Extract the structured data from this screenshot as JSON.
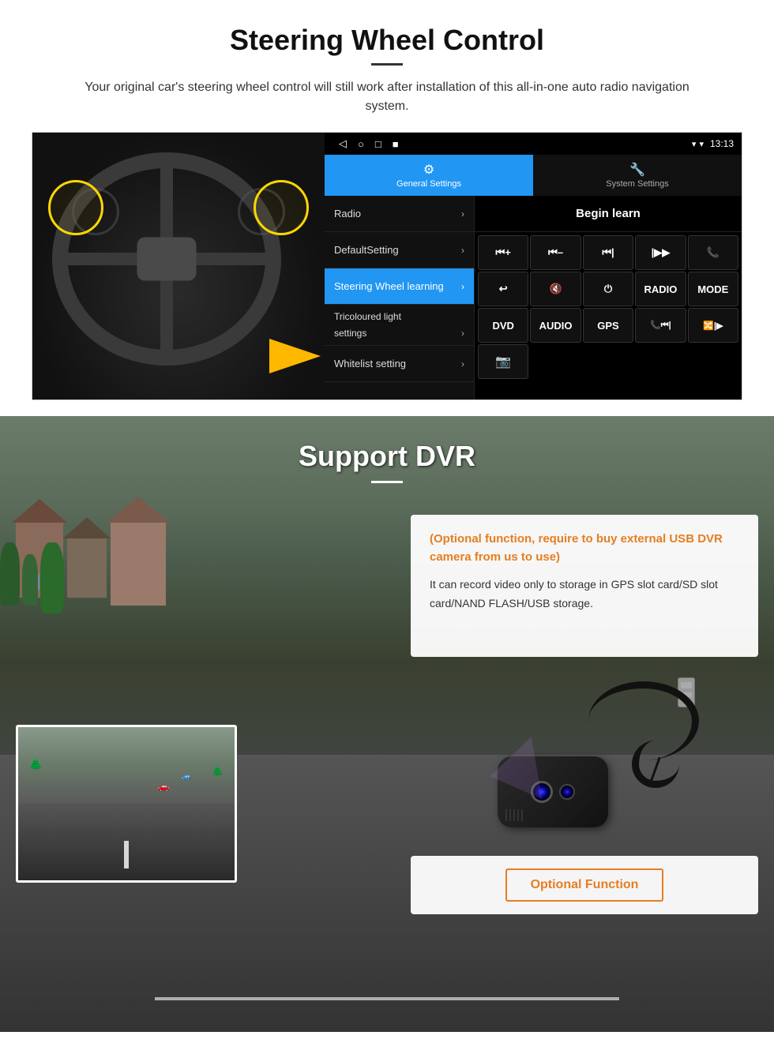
{
  "page": {
    "section1": {
      "title": "Steering Wheel Control",
      "subtitle": "Your original car's steering wheel control will still work after installation of this all-in-one auto radio navigation system.",
      "android_ui": {
        "status_time": "13:13",
        "nav_icons": [
          "◁",
          "○",
          "□",
          "■"
        ],
        "tabs": [
          {
            "label": "General Settings",
            "icon": "⚙",
            "active": true
          },
          {
            "label": "System Settings",
            "icon": "🔧",
            "active": false
          }
        ],
        "menu_items": [
          {
            "label": "Radio",
            "active": false
          },
          {
            "label": "DefaultSetting",
            "active": false
          },
          {
            "label": "Steering Wheel learning",
            "active": true
          },
          {
            "label": "Tricoloured light settings",
            "active": false
          },
          {
            "label": "Whitelist setting",
            "active": false
          }
        ],
        "begin_learn": "Begin learn",
        "control_buttons": [
          "⏮+",
          "⏮–",
          "⏮|",
          "|▶▶",
          "📞",
          "↩",
          "🔇",
          "⏻",
          "RADIO",
          "MODE",
          "DVD",
          "AUDIO",
          "GPS",
          "📞⏮|",
          "🔀|▶▶",
          "📷"
        ]
      }
    },
    "section2": {
      "title": "Support DVR",
      "optional_text": "(Optional function, require to buy external USB DVR camera from us to use)",
      "desc_text": "It can record video only to storage in GPS slot card/SD slot card/NAND FLASH/USB storage.",
      "optional_function_btn": "Optional Function"
    }
  }
}
